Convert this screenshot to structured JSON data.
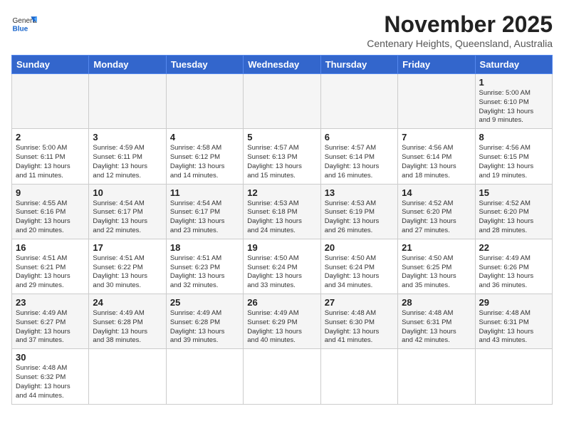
{
  "header": {
    "logo_general": "General",
    "logo_blue": "Blue",
    "title": "November 2025",
    "subtitle": "Centenary Heights, Queensland, Australia"
  },
  "weekdays": [
    "Sunday",
    "Monday",
    "Tuesday",
    "Wednesday",
    "Thursday",
    "Friday",
    "Saturday"
  ],
  "weeks": [
    [
      {
        "day": "",
        "info": ""
      },
      {
        "day": "",
        "info": ""
      },
      {
        "day": "",
        "info": ""
      },
      {
        "day": "",
        "info": ""
      },
      {
        "day": "",
        "info": ""
      },
      {
        "day": "",
        "info": ""
      },
      {
        "day": "1",
        "info": "Sunrise: 5:00 AM\nSunset: 6:10 PM\nDaylight: 13 hours\nand 9 minutes."
      }
    ],
    [
      {
        "day": "2",
        "info": "Sunrise: 5:00 AM\nSunset: 6:11 PM\nDaylight: 13 hours\nand 11 minutes."
      },
      {
        "day": "3",
        "info": "Sunrise: 4:59 AM\nSunset: 6:11 PM\nDaylight: 13 hours\nand 12 minutes."
      },
      {
        "day": "4",
        "info": "Sunrise: 4:58 AM\nSunset: 6:12 PM\nDaylight: 13 hours\nand 14 minutes."
      },
      {
        "day": "5",
        "info": "Sunrise: 4:57 AM\nSunset: 6:13 PM\nDaylight: 13 hours\nand 15 minutes."
      },
      {
        "day": "6",
        "info": "Sunrise: 4:57 AM\nSunset: 6:14 PM\nDaylight: 13 hours\nand 16 minutes."
      },
      {
        "day": "7",
        "info": "Sunrise: 4:56 AM\nSunset: 6:14 PM\nDaylight: 13 hours\nand 18 minutes."
      },
      {
        "day": "8",
        "info": "Sunrise: 4:56 AM\nSunset: 6:15 PM\nDaylight: 13 hours\nand 19 minutes."
      }
    ],
    [
      {
        "day": "9",
        "info": "Sunrise: 4:55 AM\nSunset: 6:16 PM\nDaylight: 13 hours\nand 20 minutes."
      },
      {
        "day": "10",
        "info": "Sunrise: 4:54 AM\nSunset: 6:17 PM\nDaylight: 13 hours\nand 22 minutes."
      },
      {
        "day": "11",
        "info": "Sunrise: 4:54 AM\nSunset: 6:17 PM\nDaylight: 13 hours\nand 23 minutes."
      },
      {
        "day": "12",
        "info": "Sunrise: 4:53 AM\nSunset: 6:18 PM\nDaylight: 13 hours\nand 24 minutes."
      },
      {
        "day": "13",
        "info": "Sunrise: 4:53 AM\nSunset: 6:19 PM\nDaylight: 13 hours\nand 26 minutes."
      },
      {
        "day": "14",
        "info": "Sunrise: 4:52 AM\nSunset: 6:20 PM\nDaylight: 13 hours\nand 27 minutes."
      },
      {
        "day": "15",
        "info": "Sunrise: 4:52 AM\nSunset: 6:20 PM\nDaylight: 13 hours\nand 28 minutes."
      }
    ],
    [
      {
        "day": "16",
        "info": "Sunrise: 4:51 AM\nSunset: 6:21 PM\nDaylight: 13 hours\nand 29 minutes."
      },
      {
        "day": "17",
        "info": "Sunrise: 4:51 AM\nSunset: 6:22 PM\nDaylight: 13 hours\nand 30 minutes."
      },
      {
        "day": "18",
        "info": "Sunrise: 4:51 AM\nSunset: 6:23 PM\nDaylight: 13 hours\nand 32 minutes."
      },
      {
        "day": "19",
        "info": "Sunrise: 4:50 AM\nSunset: 6:24 PM\nDaylight: 13 hours\nand 33 minutes."
      },
      {
        "day": "20",
        "info": "Sunrise: 4:50 AM\nSunset: 6:24 PM\nDaylight: 13 hours\nand 34 minutes."
      },
      {
        "day": "21",
        "info": "Sunrise: 4:50 AM\nSunset: 6:25 PM\nDaylight: 13 hours\nand 35 minutes."
      },
      {
        "day": "22",
        "info": "Sunrise: 4:49 AM\nSunset: 6:26 PM\nDaylight: 13 hours\nand 36 minutes."
      }
    ],
    [
      {
        "day": "23",
        "info": "Sunrise: 4:49 AM\nSunset: 6:27 PM\nDaylight: 13 hours\nand 37 minutes."
      },
      {
        "day": "24",
        "info": "Sunrise: 4:49 AM\nSunset: 6:28 PM\nDaylight: 13 hours\nand 38 minutes."
      },
      {
        "day": "25",
        "info": "Sunrise: 4:49 AM\nSunset: 6:28 PM\nDaylight: 13 hours\nand 39 minutes."
      },
      {
        "day": "26",
        "info": "Sunrise: 4:49 AM\nSunset: 6:29 PM\nDaylight: 13 hours\nand 40 minutes."
      },
      {
        "day": "27",
        "info": "Sunrise: 4:48 AM\nSunset: 6:30 PM\nDaylight: 13 hours\nand 41 minutes."
      },
      {
        "day": "28",
        "info": "Sunrise: 4:48 AM\nSunset: 6:31 PM\nDaylight: 13 hours\nand 42 minutes."
      },
      {
        "day": "29",
        "info": "Sunrise: 4:48 AM\nSunset: 6:31 PM\nDaylight: 13 hours\nand 43 minutes."
      }
    ],
    [
      {
        "day": "30",
        "info": "Sunrise: 4:48 AM\nSunset: 6:32 PM\nDaylight: 13 hours\nand 44 minutes."
      },
      {
        "day": "",
        "info": ""
      },
      {
        "day": "",
        "info": ""
      },
      {
        "day": "",
        "info": ""
      },
      {
        "day": "",
        "info": ""
      },
      {
        "day": "",
        "info": ""
      },
      {
        "day": "",
        "info": ""
      }
    ]
  ]
}
